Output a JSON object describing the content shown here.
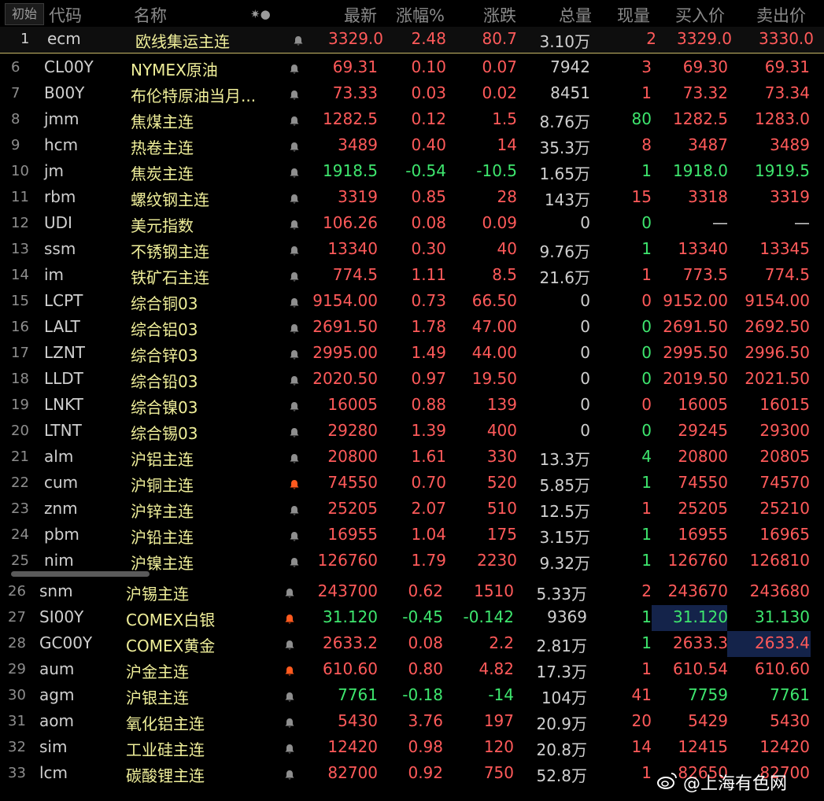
{
  "header": {
    "init_button": "初始",
    "cols": [
      "代码",
      "名称",
      "✷●",
      "最新",
      "涨幅%",
      "涨跌",
      "总量",
      "现量",
      "买入价",
      "卖出价"
    ]
  },
  "colors": {
    "up": "#ff5a5a",
    "down": "#3ee66e",
    "flat": "#d0d0d0",
    "name": "#f0ef9a",
    "highlight": "#14234a"
  },
  "rows": [
    {
      "idx": "1",
      "code": "ecm",
      "name": "欧线集运主连",
      "bell": "gray",
      "last": "3329.0",
      "pct": "2.48",
      "chg": "80.7",
      "vol": "3.10万",
      "cur": "2",
      "bid": "3329.0",
      "ask": "3330.0",
      "dir": "up",
      "cur_dir": "up",
      "selected": true
    },
    {
      "idx": "6",
      "code": "CL00Y",
      "name": "NYMEX原油",
      "bell": "gray",
      "last": "69.31",
      "pct": "0.10",
      "chg": "0.07",
      "vol": "7942",
      "cur": "3",
      "bid": "69.30",
      "ask": "69.31",
      "dir": "up",
      "cur_dir": "up"
    },
    {
      "idx": "7",
      "code": "B00Y",
      "name": "布伦特原油当月...",
      "bell": "gray",
      "last": "73.33",
      "pct": "0.03",
      "chg": "0.02",
      "vol": "8451",
      "cur": "1",
      "bid": "73.32",
      "ask": "73.34",
      "dir": "up",
      "cur_dir": "up"
    },
    {
      "idx": "8",
      "code": "jmm",
      "name": "焦煤主连",
      "bell": "gray",
      "last": "1282.5",
      "pct": "0.12",
      "chg": "1.5",
      "vol": "8.76万",
      "cur": "80",
      "bid": "1282.5",
      "ask": "1283.0",
      "dir": "up",
      "cur_dir": "down"
    },
    {
      "idx": "9",
      "code": "hcm",
      "name": "热卷主连",
      "bell": "gray",
      "last": "3489",
      "pct": "0.40",
      "chg": "14",
      "vol": "35.3万",
      "cur": "8",
      "bid": "3487",
      "ask": "3489",
      "dir": "up",
      "cur_dir": "up"
    },
    {
      "idx": "10",
      "code": "jm",
      "name": "焦炭主连",
      "bell": "gray",
      "last": "1918.5",
      "pct": "-0.54",
      "chg": "-10.5",
      "vol": "1.65万",
      "cur": "1",
      "bid": "1918.0",
      "ask": "1919.5",
      "dir": "down",
      "cur_dir": "down"
    },
    {
      "idx": "11",
      "code": "rbm",
      "name": "螺纹钢主连",
      "bell": "gray",
      "last": "3319",
      "pct": "0.85",
      "chg": "28",
      "vol": "143万",
      "cur": "15",
      "bid": "3318",
      "ask": "3319",
      "dir": "up",
      "cur_dir": "up"
    },
    {
      "idx": "12",
      "code": "UDI",
      "name": "美元指数",
      "bell": "gray",
      "last": "106.26",
      "pct": "0.08",
      "chg": "0.09",
      "vol": "0",
      "cur": "0",
      "bid": "—",
      "ask": "—",
      "dir": "up",
      "cur_dir": "down",
      "bidask_flat": true
    },
    {
      "idx": "13",
      "code": "ssm",
      "name": "不锈钢主连",
      "bell": "gray",
      "last": "13340",
      "pct": "0.30",
      "chg": "40",
      "vol": "9.76万",
      "cur": "1",
      "bid": "13340",
      "ask": "13345",
      "dir": "up",
      "cur_dir": "down"
    },
    {
      "idx": "14",
      "code": "im",
      "name": "铁矿石主连",
      "bell": "gray",
      "last": "774.5",
      "pct": "1.11",
      "chg": "8.5",
      "vol": "21.6万",
      "cur": "1",
      "bid": "773.5",
      "ask": "774.5",
      "dir": "up",
      "cur_dir": "up"
    },
    {
      "idx": "15",
      "code": "LCPT",
      "name": "综合铜03",
      "bell": "gray",
      "last": "9154.00",
      "pct": "0.73",
      "chg": "66.50",
      "vol": "0",
      "cur": "0",
      "bid": "9152.00",
      "ask": "9154.00",
      "dir": "up",
      "cur_dir": "up"
    },
    {
      "idx": "16",
      "code": "LALT",
      "name": "综合铝03",
      "bell": "gray",
      "last": "2691.50",
      "pct": "1.78",
      "chg": "47.00",
      "vol": "0",
      "cur": "0",
      "bid": "2691.50",
      "ask": "2692.50",
      "dir": "up",
      "cur_dir": "down"
    },
    {
      "idx": "17",
      "code": "LZNT",
      "name": "综合锌03",
      "bell": "gray",
      "last": "2995.00",
      "pct": "1.49",
      "chg": "44.00",
      "vol": "0",
      "cur": "0",
      "bid": "2995.50",
      "ask": "2996.50",
      "dir": "up",
      "cur_dir": "down"
    },
    {
      "idx": "18",
      "code": "LLDT",
      "name": "综合铅03",
      "bell": "gray",
      "last": "2020.50",
      "pct": "0.97",
      "chg": "19.50",
      "vol": "0",
      "cur": "0",
      "bid": "2019.50",
      "ask": "2021.50",
      "dir": "up",
      "cur_dir": "down"
    },
    {
      "idx": "19",
      "code": "LNKT",
      "name": "综合镍03",
      "bell": "gray",
      "last": "16005",
      "pct": "0.88",
      "chg": "139",
      "vol": "0",
      "cur": "0",
      "bid": "16005",
      "ask": "16015",
      "dir": "up",
      "cur_dir": "up"
    },
    {
      "idx": "20",
      "code": "LTNT",
      "name": "综合锡03",
      "bell": "gray",
      "last": "29280",
      "pct": "1.39",
      "chg": "400",
      "vol": "0",
      "cur": "0",
      "bid": "29245",
      "ask": "29300",
      "dir": "up",
      "cur_dir": "down"
    },
    {
      "idx": "21",
      "code": "alm",
      "name": "沪铝主连",
      "bell": "gray",
      "last": "20800",
      "pct": "1.61",
      "chg": "330",
      "vol": "13.3万",
      "cur": "4",
      "bid": "20800",
      "ask": "20805",
      "dir": "up",
      "cur_dir": "down"
    },
    {
      "idx": "22",
      "code": "cum",
      "name": "沪铜主连",
      "bell": "orange",
      "last": "74550",
      "pct": "0.70",
      "chg": "520",
      "vol": "5.85万",
      "cur": "1",
      "bid": "74550",
      "ask": "74570",
      "dir": "up",
      "cur_dir": "down"
    },
    {
      "idx": "23",
      "code": "znm",
      "name": "沪锌主连",
      "bell": "gray",
      "last": "25205",
      "pct": "2.07",
      "chg": "510",
      "vol": "12.5万",
      "cur": "1",
      "bid": "25205",
      "ask": "25210",
      "dir": "up",
      "cur_dir": "up"
    },
    {
      "idx": "24",
      "code": "pbm",
      "name": "沪铅主连",
      "bell": "gray",
      "last": "16955",
      "pct": "1.04",
      "chg": "175",
      "vol": "3.15万",
      "cur": "1",
      "bid": "16955",
      "ask": "16965",
      "dir": "up",
      "cur_dir": "down"
    },
    {
      "idx": "25",
      "code": "nim",
      "name": "沪镍主连",
      "bell": "gray",
      "last": "126760",
      "pct": "1.79",
      "chg": "2230",
      "vol": "9.32万",
      "cur": "1",
      "bid": "126760",
      "ask": "126810",
      "dir": "up",
      "cur_dir": "down"
    },
    {
      "idx": "26",
      "code": "snm",
      "name": "沪锡主连",
      "bell": "gray",
      "last": "243700",
      "pct": "0.62",
      "chg": "1510",
      "vol": "5.33万",
      "cur": "2",
      "bid": "243670",
      "ask": "243680",
      "dir": "up",
      "cur_dir": "up"
    },
    {
      "idx": "27",
      "code": "SI00Y",
      "name": "COMEX白银",
      "bell": "orange",
      "last": "31.120",
      "pct": "-0.45",
      "chg": "-0.142",
      "vol": "9369",
      "cur": "1",
      "bid": "31.120",
      "ask": "31.130",
      "dir": "down",
      "cur_dir": "down",
      "hl": "bid"
    },
    {
      "idx": "28",
      "code": "GC00Y",
      "name": "COMEX黄金",
      "bell": "gray",
      "last": "2633.2",
      "pct": "0.08",
      "chg": "2.2",
      "vol": "2.81万",
      "cur": "1",
      "bid": "2633.3",
      "ask": "2633.4",
      "dir": "up",
      "cur_dir": "down",
      "hl": "ask"
    },
    {
      "idx": "29",
      "code": "aum",
      "name": "沪金主连",
      "bell": "orange",
      "last": "610.60",
      "pct": "0.80",
      "chg": "4.82",
      "vol": "17.3万",
      "cur": "1",
      "bid": "610.54",
      "ask": "610.60",
      "dir": "up",
      "cur_dir": "up"
    },
    {
      "idx": "30",
      "code": "agm",
      "name": "沪银主连",
      "bell": "gray",
      "last": "7761",
      "pct": "-0.18",
      "chg": "-14",
      "vol": "104万",
      "cur": "41",
      "bid": "7759",
      "ask": "7761",
      "dir": "down",
      "cur_dir": "up"
    },
    {
      "idx": "31",
      "code": "aom",
      "name": "氧化铝主连",
      "bell": "gray",
      "last": "5430",
      "pct": "3.76",
      "chg": "197",
      "vol": "20.9万",
      "cur": "20",
      "bid": "5429",
      "ask": "5430",
      "dir": "up",
      "cur_dir": "up"
    },
    {
      "idx": "32",
      "code": "sim",
      "name": "工业硅主连",
      "bell": "gray",
      "last": "12420",
      "pct": "0.98",
      "chg": "120",
      "vol": "20.8万",
      "cur": "14",
      "bid": "12415",
      "ask": "12420",
      "dir": "up",
      "cur_dir": "up"
    },
    {
      "idx": "33",
      "code": "lcm",
      "name": "碳酸锂主连",
      "bell": "gray",
      "last": "82700",
      "pct": "0.92",
      "chg": "750",
      "vol": "52.8万",
      "cur": "1",
      "bid": "82650",
      "ask": "82700",
      "dir": "up",
      "cur_dir": "up"
    }
  ],
  "watermark": "@上海有色网"
}
